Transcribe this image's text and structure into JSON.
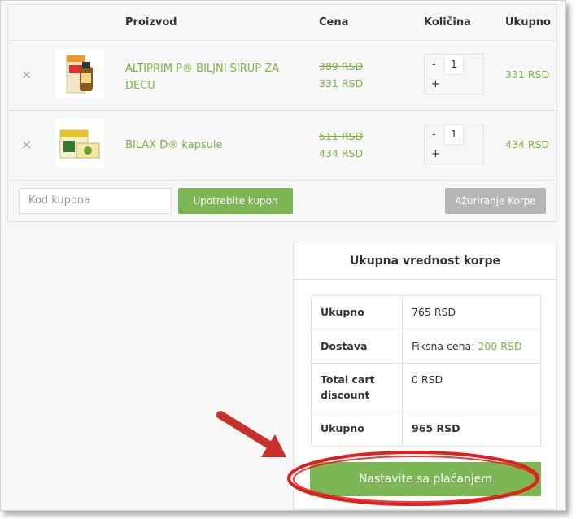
{
  "cart": {
    "headers": {
      "product": "Proizvod",
      "price": "Cena",
      "quantity": "Količina",
      "total": "Ukupno"
    },
    "items": [
      {
        "remove": "×",
        "name_line1": "ALTIPRIM P® BILJNI SIRUP ZA",
        "name_line2": "DECU",
        "old_price": "389 RSD",
        "new_price": "331 RSD",
        "qty": "1",
        "minus": "-",
        "plus": "+",
        "total": "331 RSD"
      },
      {
        "remove": "×",
        "name_line1": "BILAX D® kapsule",
        "name_line2": "",
        "old_price": "511 RSD",
        "new_price": "434 RSD",
        "qty": "1",
        "minus": "-",
        "plus": "+",
        "total": "434 RSD"
      }
    ],
    "coupon_placeholder": "Kod kupona",
    "apply_coupon": "Upotrebite kupon",
    "update_cart": "Ažuriranje Korpe"
  },
  "totals": {
    "title": "Ukupna vrednost korpe",
    "subtotal_label": "Ukupno",
    "subtotal_value": "765 RSD",
    "shipping_label": "Dostava",
    "shipping_prefix": "Fiksna cena: ",
    "shipping_value": "200 RSD",
    "discount_label_1": "Total cart",
    "discount_label_2": "discount",
    "discount_value": "0 RSD",
    "total_label": "Ukupno",
    "total_value": "965 RSD",
    "checkout": "Nastavite sa plaćanjem"
  },
  "colors": {
    "accent": "#7cb342",
    "button_green": "#7cb655",
    "button_gray": "#b6b6b6",
    "annotation": "#e0201c"
  }
}
